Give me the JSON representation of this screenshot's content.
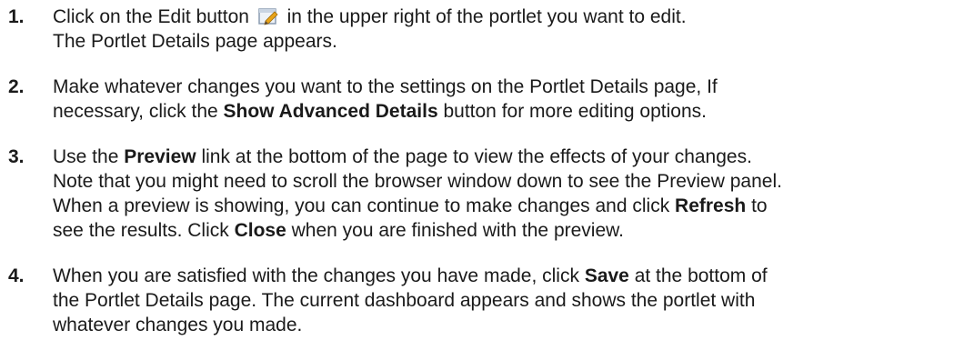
{
  "steps": [
    {
      "number": "1.",
      "lines": [
        {
          "a": "Click on the Edit button",
          "b": "in the upper right of the portlet you want to edit."
        },
        {
          "a": "The Portlet Details page appears."
        }
      ],
      "icon": "edit-pencil-icon"
    },
    {
      "number": "2.",
      "lines": [
        {
          "a": "Make whatever changes you want to the settings on the Portlet Details page,  If"
        },
        {
          "a": "necessary, click the ",
          "b1": "Show Advanced Details",
          "c": " button for more editing options."
        }
      ]
    },
    {
      "number": "3.",
      "lines": [
        {
          "a": "Use the ",
          "b1": "Preview",
          "c": " link at the bottom of the page to view the effects of your changes."
        },
        {
          "a": "Note that you might need to scroll the browser window down to see the Preview panel."
        },
        {
          "a": "When a preview is showing, you can continue to make changes and click ",
          "b1": "Refresh",
          "c": " to"
        },
        {
          "a": "see the results. Click ",
          "b1": "Close",
          "c": " when you are finished with the preview."
        }
      ]
    },
    {
      "number": "4.",
      "lines": [
        {
          "a": "When you are satisfied with the changes you have made, click ",
          "b1": "Save",
          "c": " at the bottom of"
        },
        {
          "a": "the Portlet Details page. The current dashboard appears and shows the portlet with"
        },
        {
          "a": "whatever changes you made."
        }
      ]
    }
  ],
  "colors": {
    "text": "#1a1a1a",
    "icon_frame": "#8a9bb0",
    "icon_pencil": "#e8a317"
  }
}
